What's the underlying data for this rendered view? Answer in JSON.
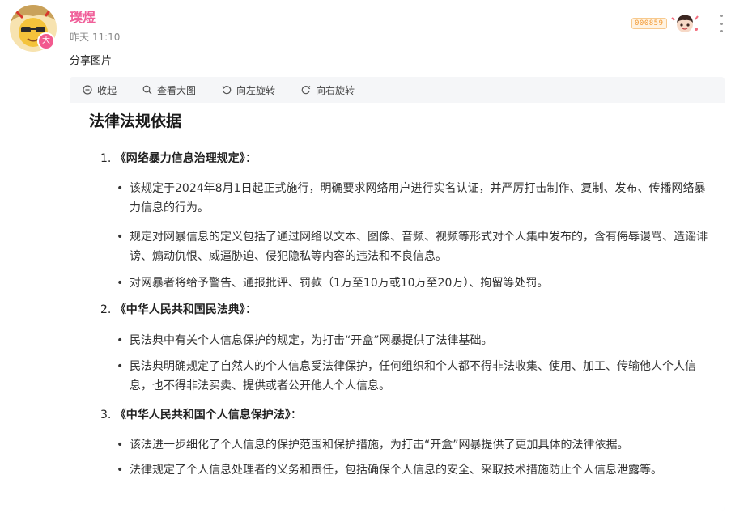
{
  "message": {
    "username": "璞煜",
    "timestamp": "昨天 11:10",
    "text": "分享图片",
    "avatar_badge": "大",
    "fan_badge_number": "000859"
  },
  "toolbar": {
    "collapse_label": "收起",
    "view_large_label": "查看大图",
    "rotate_left_label": "向左旋转",
    "rotate_right_label": "向右旋转"
  },
  "document": {
    "title": "法律法规依据",
    "sections": [
      {
        "number": "1.",
        "name": "《网络暴力信息治理规定》",
        "suffix": "：",
        "bullets": [
          "该规定于2024年8月1日起正式施行，明确要求网络用户进行实名认证，并严厉打击制作、复制、发布、传播网络暴力信息的行为。",
          "规定对网暴信息的定义包括了通过网络以文本、图像、音频、视频等形式对个人集中发布的，含有侮辱谩骂、造谣诽谤、煽动仇恨、威逼胁迫、侵犯隐私等内容的违法和不良信息。",
          "对网暴者将给予警告、通报批评、罚款（1万至10万或10万至20万）、拘留等处罚。"
        ]
      },
      {
        "number": "2.",
        "name": "《中华人民共和国民法典》",
        "suffix": "：",
        "bullets": [
          "民法典中有关个人信息保护的规定，为打击“开盒”网暴提供了法律基础。",
          "民法典明确规定了自然人的个人信息受法律保护，任何组织和个人都不得非法收集、使用、加工、传输他人个人信息，也不得非法买卖、提供或者公开他人个人信息。"
        ]
      },
      {
        "number": "3.",
        "name": "《中华人民共和国个人信息保护法》",
        "suffix": "：",
        "bullets": [
          "该法进一步细化了个人信息的保护范围和保护措施，为打击“开盒”网暴提供了更加具体的法律依据。",
          "法律规定了个人信息处理者的义务和责任，包括确保个人信息的安全、采取技术措施防止个人信息泄露等。"
        ]
      }
    ]
  },
  "colors": {
    "username": "#f0609a",
    "panel_bg": "#f5f6f8",
    "fan_badge": "#f39a34"
  }
}
